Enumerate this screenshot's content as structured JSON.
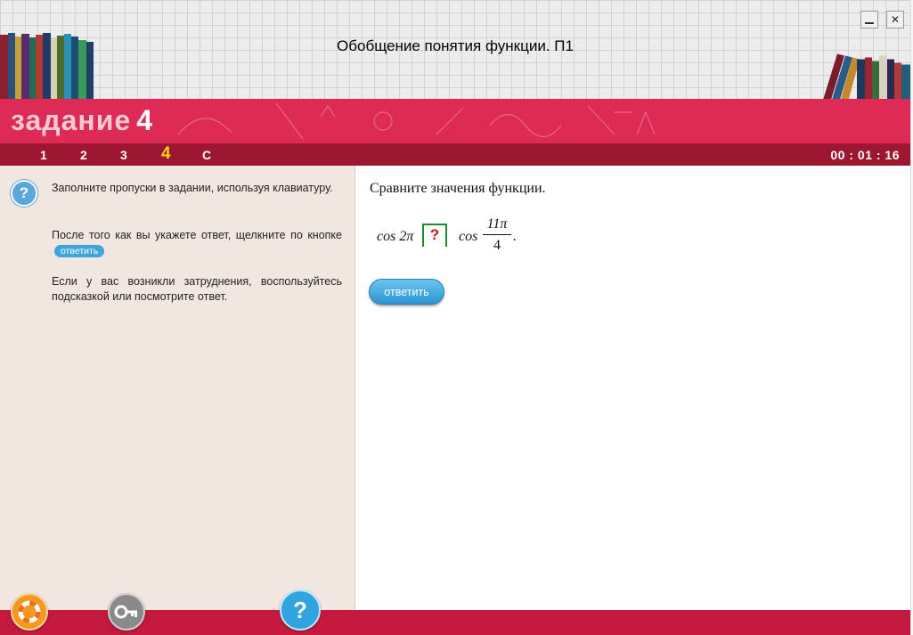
{
  "window": {
    "title": "Обобщение понятия функции. П1",
    "minimize_icon": "minimize-icon",
    "close_icon": "close-icon",
    "close_glyph": "✕"
  },
  "banner": {
    "label": "задание",
    "number": "4"
  },
  "nav": {
    "items": [
      "1",
      "2",
      "3",
      "4",
      "C"
    ],
    "active": "4",
    "timer": "00 : 01 : 16"
  },
  "instructions": {
    "p1": "Заполните пропуски в задании, используя клавиатуру.",
    "p2": "После того как вы укажете ответ, щелкните по кнопке",
    "p2_button": "ответить",
    "p3": "Если у вас возникли затруднения, воспользуйтесь подсказкой или посмотрите ответ."
  },
  "task": {
    "question": "Сравните значения функции.",
    "left_expr": "cos 2π",
    "blank_mark": "?",
    "right_func": "cos",
    "frac_num": "11π",
    "frac_den": "4",
    "end": "."
  },
  "answer_button": "ответить",
  "bottom": {
    "help_glyph": "?"
  },
  "colors": {
    "banner": "#dd2b55",
    "nav": "#9d1632",
    "active_nav": "#ffd21a",
    "panel": "#f1e6e0",
    "button": "#2fa4de"
  }
}
